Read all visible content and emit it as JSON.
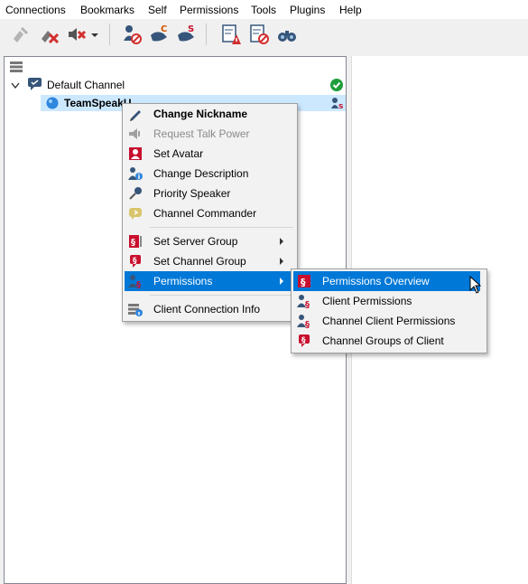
{
  "menubar": [
    "Connections",
    "Bookmarks",
    "Self",
    "Permissions",
    "Tools",
    "Plugins",
    "Help"
  ],
  "tree": {
    "channel": "Default Channel",
    "client": "TeamSpeakU"
  },
  "context_menu": {
    "items": [
      {
        "label": "Change Nickname",
        "bold": true
      },
      {
        "label": "Request Talk Power",
        "disabled": true
      },
      {
        "label": "Set Avatar"
      },
      {
        "label": "Change Description"
      },
      {
        "label": "Priority Speaker"
      },
      {
        "label": "Channel Commander"
      },
      {
        "label": "Set Server Group",
        "submenu": true
      },
      {
        "label": "Set Channel Group",
        "submenu": true
      },
      {
        "label": "Permissions",
        "submenu": true,
        "highlighted": true
      },
      {
        "label": "Client Connection Info"
      }
    ]
  },
  "submenu": {
    "items": [
      {
        "label": "Permissions Overview",
        "highlighted": true
      },
      {
        "label": "Client Permissions"
      },
      {
        "label": "Channel Client Permissions"
      },
      {
        "label": "Channel Groups of Client"
      }
    ]
  },
  "colors": {
    "highlight": "#0078d7",
    "permission_red": "#c8102e",
    "ok_green": "#1e9e3a"
  }
}
